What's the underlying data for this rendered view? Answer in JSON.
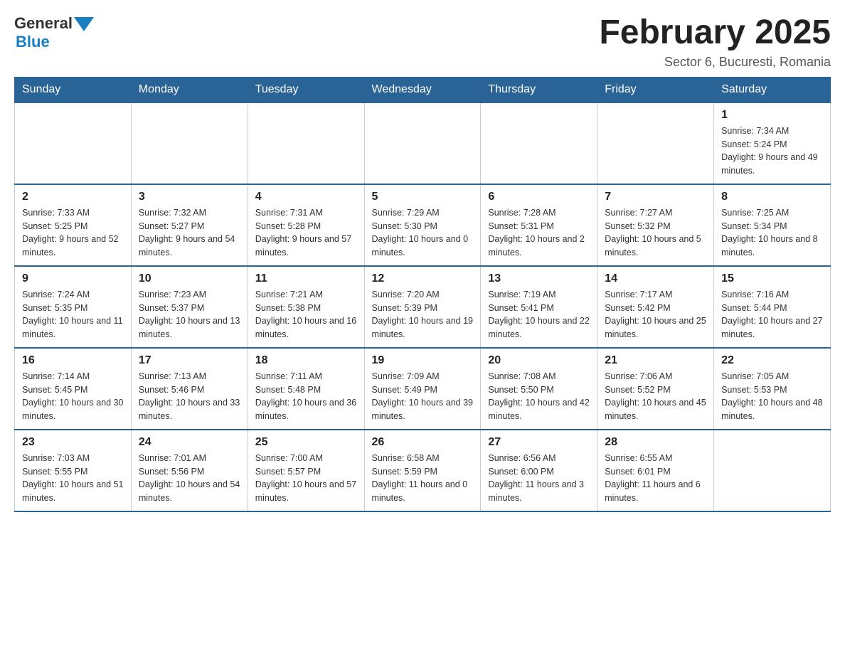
{
  "header": {
    "logo": {
      "general_text": "General",
      "blue_text": "Blue"
    },
    "title": "February 2025",
    "location": "Sector 6, Bucuresti, Romania"
  },
  "days_of_week": [
    "Sunday",
    "Monday",
    "Tuesday",
    "Wednesday",
    "Thursday",
    "Friday",
    "Saturday"
  ],
  "weeks": [
    [
      {
        "day": "",
        "info": ""
      },
      {
        "day": "",
        "info": ""
      },
      {
        "day": "",
        "info": ""
      },
      {
        "day": "",
        "info": ""
      },
      {
        "day": "",
        "info": ""
      },
      {
        "day": "",
        "info": ""
      },
      {
        "day": "1",
        "info": "Sunrise: 7:34 AM\nSunset: 5:24 PM\nDaylight: 9 hours and 49 minutes."
      }
    ],
    [
      {
        "day": "2",
        "info": "Sunrise: 7:33 AM\nSunset: 5:25 PM\nDaylight: 9 hours and 52 minutes."
      },
      {
        "day": "3",
        "info": "Sunrise: 7:32 AM\nSunset: 5:27 PM\nDaylight: 9 hours and 54 minutes."
      },
      {
        "day": "4",
        "info": "Sunrise: 7:31 AM\nSunset: 5:28 PM\nDaylight: 9 hours and 57 minutes."
      },
      {
        "day": "5",
        "info": "Sunrise: 7:29 AM\nSunset: 5:30 PM\nDaylight: 10 hours and 0 minutes."
      },
      {
        "day": "6",
        "info": "Sunrise: 7:28 AM\nSunset: 5:31 PM\nDaylight: 10 hours and 2 minutes."
      },
      {
        "day": "7",
        "info": "Sunrise: 7:27 AM\nSunset: 5:32 PM\nDaylight: 10 hours and 5 minutes."
      },
      {
        "day": "8",
        "info": "Sunrise: 7:25 AM\nSunset: 5:34 PM\nDaylight: 10 hours and 8 minutes."
      }
    ],
    [
      {
        "day": "9",
        "info": "Sunrise: 7:24 AM\nSunset: 5:35 PM\nDaylight: 10 hours and 11 minutes."
      },
      {
        "day": "10",
        "info": "Sunrise: 7:23 AM\nSunset: 5:37 PM\nDaylight: 10 hours and 13 minutes."
      },
      {
        "day": "11",
        "info": "Sunrise: 7:21 AM\nSunset: 5:38 PM\nDaylight: 10 hours and 16 minutes."
      },
      {
        "day": "12",
        "info": "Sunrise: 7:20 AM\nSunset: 5:39 PM\nDaylight: 10 hours and 19 minutes."
      },
      {
        "day": "13",
        "info": "Sunrise: 7:19 AM\nSunset: 5:41 PM\nDaylight: 10 hours and 22 minutes."
      },
      {
        "day": "14",
        "info": "Sunrise: 7:17 AM\nSunset: 5:42 PM\nDaylight: 10 hours and 25 minutes."
      },
      {
        "day": "15",
        "info": "Sunrise: 7:16 AM\nSunset: 5:44 PM\nDaylight: 10 hours and 27 minutes."
      }
    ],
    [
      {
        "day": "16",
        "info": "Sunrise: 7:14 AM\nSunset: 5:45 PM\nDaylight: 10 hours and 30 minutes."
      },
      {
        "day": "17",
        "info": "Sunrise: 7:13 AM\nSunset: 5:46 PM\nDaylight: 10 hours and 33 minutes."
      },
      {
        "day": "18",
        "info": "Sunrise: 7:11 AM\nSunset: 5:48 PM\nDaylight: 10 hours and 36 minutes."
      },
      {
        "day": "19",
        "info": "Sunrise: 7:09 AM\nSunset: 5:49 PM\nDaylight: 10 hours and 39 minutes."
      },
      {
        "day": "20",
        "info": "Sunrise: 7:08 AM\nSunset: 5:50 PM\nDaylight: 10 hours and 42 minutes."
      },
      {
        "day": "21",
        "info": "Sunrise: 7:06 AM\nSunset: 5:52 PM\nDaylight: 10 hours and 45 minutes."
      },
      {
        "day": "22",
        "info": "Sunrise: 7:05 AM\nSunset: 5:53 PM\nDaylight: 10 hours and 48 minutes."
      }
    ],
    [
      {
        "day": "23",
        "info": "Sunrise: 7:03 AM\nSunset: 5:55 PM\nDaylight: 10 hours and 51 minutes."
      },
      {
        "day": "24",
        "info": "Sunrise: 7:01 AM\nSunset: 5:56 PM\nDaylight: 10 hours and 54 minutes."
      },
      {
        "day": "25",
        "info": "Sunrise: 7:00 AM\nSunset: 5:57 PM\nDaylight: 10 hours and 57 minutes."
      },
      {
        "day": "26",
        "info": "Sunrise: 6:58 AM\nSunset: 5:59 PM\nDaylight: 11 hours and 0 minutes."
      },
      {
        "day": "27",
        "info": "Sunrise: 6:56 AM\nSunset: 6:00 PM\nDaylight: 11 hours and 3 minutes."
      },
      {
        "day": "28",
        "info": "Sunrise: 6:55 AM\nSunset: 6:01 PM\nDaylight: 11 hours and 6 minutes."
      },
      {
        "day": "",
        "info": ""
      }
    ]
  ]
}
